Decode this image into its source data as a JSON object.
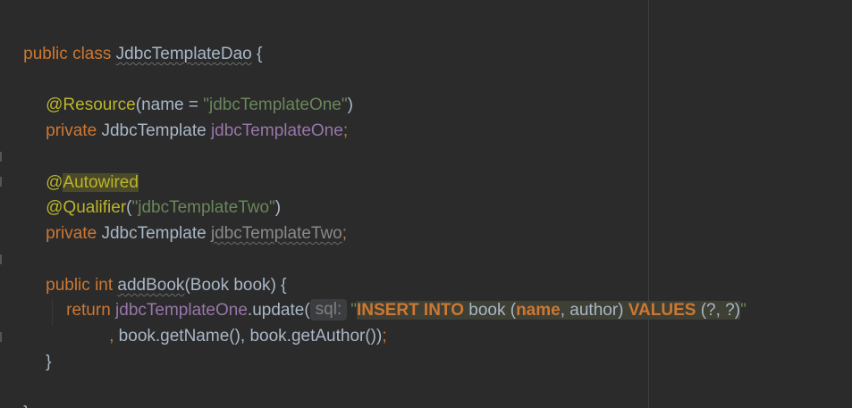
{
  "code": {
    "l1": {
      "kw1": "public",
      "kw2": "class",
      "name": "JdbcTemplateDao",
      "brace": "{"
    },
    "l3": {
      "ann": "@Resource",
      "open": "(",
      "param": "name",
      "eq": " = ",
      "str": "\"jdbcTemplateOne\"",
      "close": ")"
    },
    "l4": {
      "kw": "private",
      "type": "JdbcTemplate",
      "field": "jdbcTemplateOne",
      "semi": ";"
    },
    "l6": {
      "ann_at": "@",
      "ann": "Autowired"
    },
    "l7": {
      "ann": "@Qualifier",
      "open": "(",
      "str": "\"jdbcTemplateTwo\"",
      "close": ")"
    },
    "l8": {
      "kw": "private",
      "type": "JdbcTemplate",
      "field": "jdbcTemplateTwo",
      "semi": ";"
    },
    "l10": {
      "kw1": "public",
      "kw2": "int",
      "method": "addBook",
      "params_open": "(",
      "ptype": "Book",
      "pname": "book",
      "params_close": ") {"
    },
    "l11": {
      "kw": "return",
      "obj": "jdbcTemplateOne",
      "call": ".update(",
      "hint": "sql:",
      "q_open": "\"",
      "s_insert": "INSERT INTO",
      "s_table": " book (",
      "s_col1": "name",
      "s_comma": ", ",
      "s_col2": "author",
      "s_close": ") ",
      "s_values": "VALUES",
      "s_params": " (?, ?)",
      "q_close": "\""
    },
    "l12": {
      "comma": ",",
      "args": " book.getName(), book.getAuthor())",
      "semi": ";"
    },
    "l13": {
      "brace": "}"
    },
    "l15": {
      "brace": "}"
    }
  }
}
